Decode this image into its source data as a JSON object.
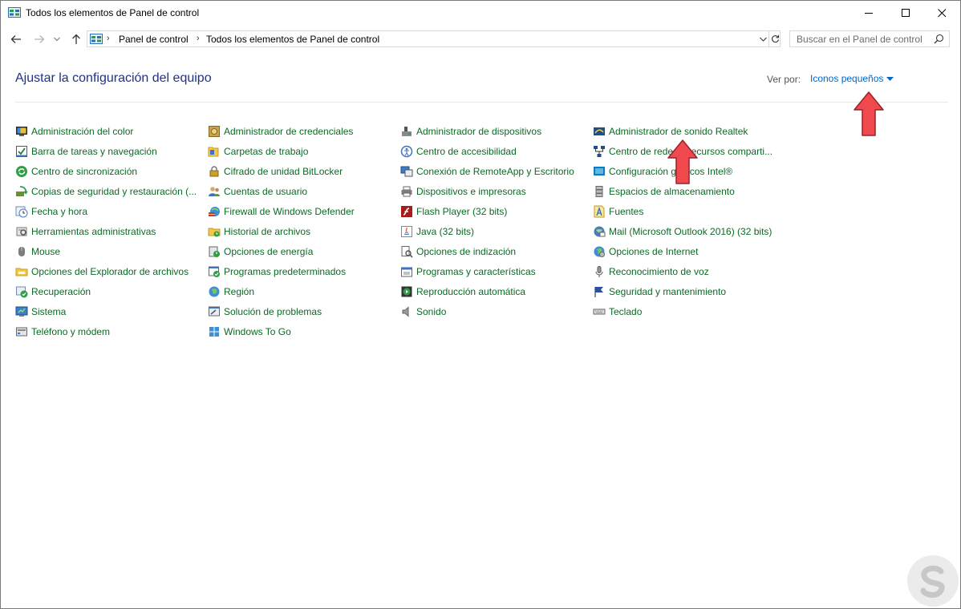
{
  "window": {
    "title": "Todos los elementos de Panel de control",
    "controls": [
      "minimize",
      "maximize",
      "close"
    ]
  },
  "nav": {
    "back_icon": "arrow-left-icon",
    "forward_icon": "arrow-right-icon",
    "recent_icon": "chevron-down-icon",
    "up_icon": "arrow-up-icon"
  },
  "address": {
    "crumbs": [
      "Panel de control",
      "Todos los elementos de Panel de control"
    ],
    "refresh_icon": "refresh-icon"
  },
  "search": {
    "placeholder": "Buscar en el Panel de control",
    "icon": "search-icon"
  },
  "header": {
    "title": "Ajustar la configuración del equipo",
    "view_by_label": "Ver por:",
    "view_by_value": "Iconos pequeños"
  },
  "colors": {
    "link_green": "#0b6a24",
    "title_blue": "#1e3287",
    "view_blue": "#0066cc",
    "arrow_red": "#f0494e"
  },
  "items": {
    "col1": [
      {
        "label": "Administración del color",
        "icon": "monitor-color-icon"
      },
      {
        "label": "Barra de tareas y navegación",
        "icon": "taskbar-icon"
      },
      {
        "label": "Centro de sincronización",
        "icon": "sync-icon"
      },
      {
        "label": "Copias de seguridad y restauración (...",
        "icon": "backup-icon"
      },
      {
        "label": "Fecha y hora",
        "icon": "clock-icon"
      },
      {
        "label": "Herramientas administrativas",
        "icon": "admin-tools-icon"
      },
      {
        "label": "Mouse",
        "icon": "mouse-icon"
      },
      {
        "label": "Opciones del Explorador de archivos",
        "icon": "folder-options-icon"
      },
      {
        "label": "Recuperación",
        "icon": "recovery-icon"
      },
      {
        "label": "Sistema",
        "icon": "system-icon"
      },
      {
        "label": "Teléfono y módem",
        "icon": "modem-icon"
      }
    ],
    "col2": [
      {
        "label": "Administrador de credenciales",
        "icon": "credential-vault-icon"
      },
      {
        "label": "Carpetas de trabajo",
        "icon": "work-folders-icon"
      },
      {
        "label": "Cifrado de unidad BitLocker",
        "icon": "bitlocker-icon"
      },
      {
        "label": "Cuentas de usuario",
        "icon": "user-accounts-icon"
      },
      {
        "label": "Firewall de Windows Defender",
        "icon": "firewall-icon"
      },
      {
        "label": "Historial de archivos",
        "icon": "file-history-icon"
      },
      {
        "label": "Opciones de energía",
        "icon": "power-options-icon"
      },
      {
        "label": "Programas predeterminados",
        "icon": "default-programs-icon"
      },
      {
        "label": "Región",
        "icon": "region-icon"
      },
      {
        "label": "Solución de problemas",
        "icon": "troubleshooting-icon"
      },
      {
        "label": "Windows To Go",
        "icon": "windows-to-go-icon"
      }
    ],
    "col3": [
      {
        "label": "Administrador de dispositivos",
        "icon": "device-manager-icon"
      },
      {
        "label": "Centro de accesibilidad",
        "icon": "accessibility-icon"
      },
      {
        "label": "Conexión de RemoteApp y Escritorio",
        "icon": "remoteapp-icon"
      },
      {
        "label": "Dispositivos e impresoras",
        "icon": "printer-icon"
      },
      {
        "label": "Flash Player (32 bits)",
        "icon": "flash-icon"
      },
      {
        "label": "Java (32 bits)",
        "icon": "java-icon"
      },
      {
        "label": "Opciones de indización",
        "icon": "indexing-icon"
      },
      {
        "label": "Programas y características",
        "icon": "programs-icon"
      },
      {
        "label": "Reproducción automática",
        "icon": "autoplay-icon"
      },
      {
        "label": "Sonido",
        "icon": "speaker-icon"
      }
    ],
    "col4": [
      {
        "label": "Administrador de sonido Realtek",
        "icon": "realtek-icon"
      },
      {
        "label": "Centro de redes y recursos comparti...",
        "icon": "network-icon"
      },
      {
        "label": "Configuración gráficos Intel®",
        "icon": "intel-graphics-icon"
      },
      {
        "label": "Espacios de almacenamiento",
        "icon": "storage-spaces-icon"
      },
      {
        "label": "Fuentes",
        "icon": "fonts-icon"
      },
      {
        "label": "Mail (Microsoft Outlook 2016) (32 bits)",
        "icon": "mail-icon"
      },
      {
        "label": "Opciones de Internet",
        "icon": "internet-options-icon"
      },
      {
        "label": "Reconocimiento de voz",
        "icon": "microphone-icon"
      },
      {
        "label": "Seguridad y mantenimiento",
        "icon": "flag-icon"
      },
      {
        "label": "Teclado",
        "icon": "keyboard-icon"
      }
    ]
  }
}
